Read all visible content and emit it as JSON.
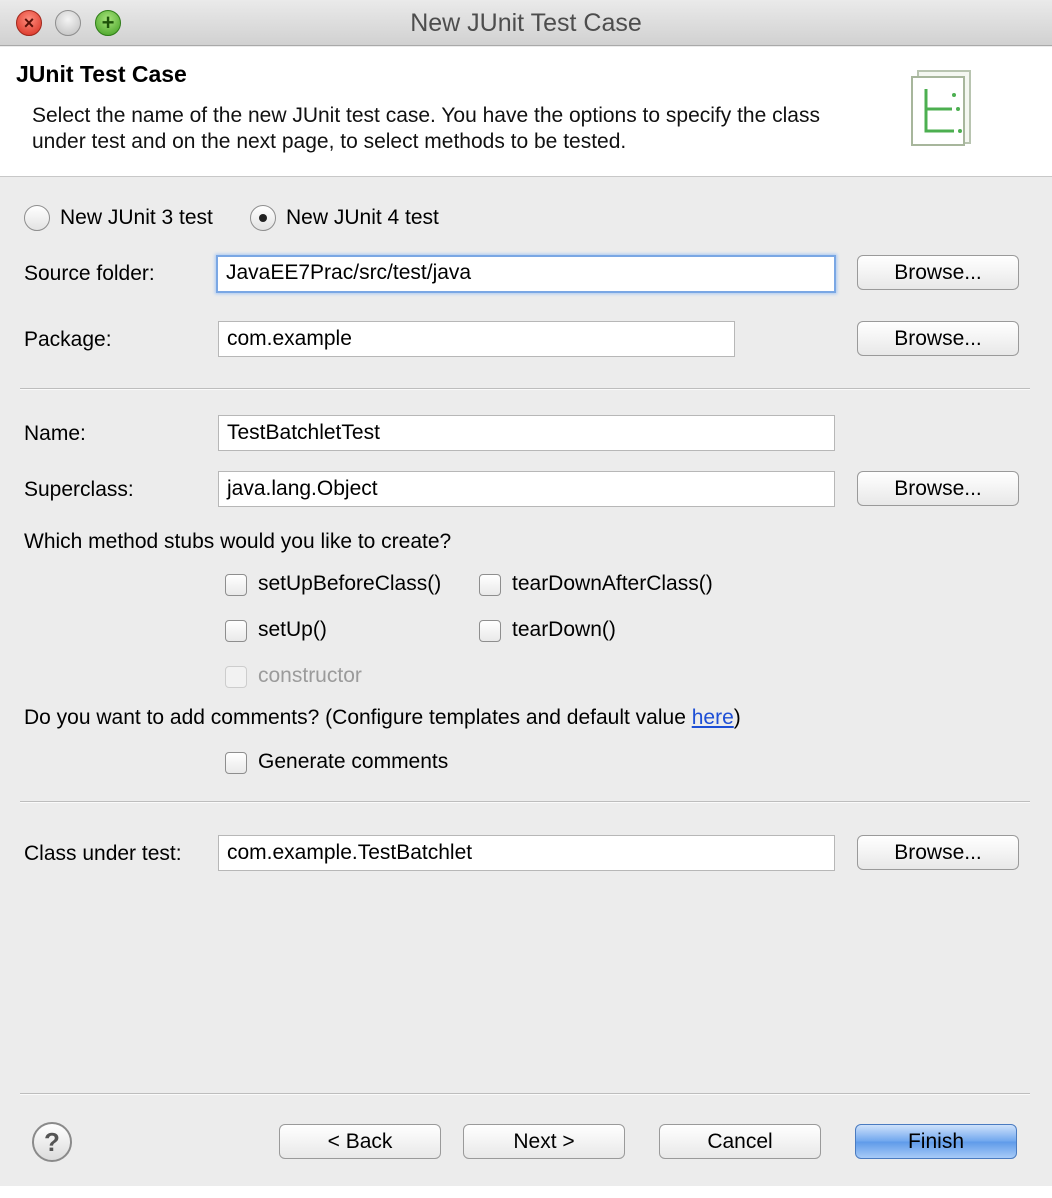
{
  "window": {
    "title": "New JUnit Test Case"
  },
  "banner": {
    "title": "JUnit Test Case",
    "description": "Select the name of the new JUnit test case. You have the options to specify the class under test and on the next page, to select methods to be tested."
  },
  "version": {
    "junit3_label": "New JUnit 3 test",
    "junit4_label": "New JUnit 4 test",
    "selected": "junit4"
  },
  "source_folder": {
    "label": "Source folder:",
    "value": "JavaEE7Prac/src/test/java",
    "browse_label": "Browse..."
  },
  "package": {
    "label": "Package:",
    "value": "com.example",
    "browse_label": "Browse..."
  },
  "name": {
    "label": "Name:",
    "value": "TestBatchletTest"
  },
  "superclass": {
    "label": "Superclass:",
    "value": "java.lang.Object",
    "browse_label": "Browse..."
  },
  "stubs": {
    "question": "Which method stubs would you like to create?",
    "setup_before_class": "setUpBeforeClass()",
    "teardown_after_class": "tearDownAfterClass()",
    "setup": "setUp()",
    "teardown": "tearDown()",
    "constructor": "constructor"
  },
  "comments": {
    "question_prefix": "Do you want to add comments? (Configure templates and default value ",
    "link": "here",
    "question_suffix": ")",
    "generate_label": "Generate comments"
  },
  "class_under_test": {
    "label": "Class under test:",
    "value": "com.example.TestBatchlet",
    "browse_label": "Browse..."
  },
  "footer": {
    "back_label": "< Back",
    "next_label": "Next >",
    "cancel_label": "Cancel",
    "finish_label": "Finish",
    "help_glyph": "?"
  },
  "colors": {
    "focus_ring": "#7aa7e4",
    "default_button": "#6fa6ee",
    "link": "#1e4fd6"
  }
}
